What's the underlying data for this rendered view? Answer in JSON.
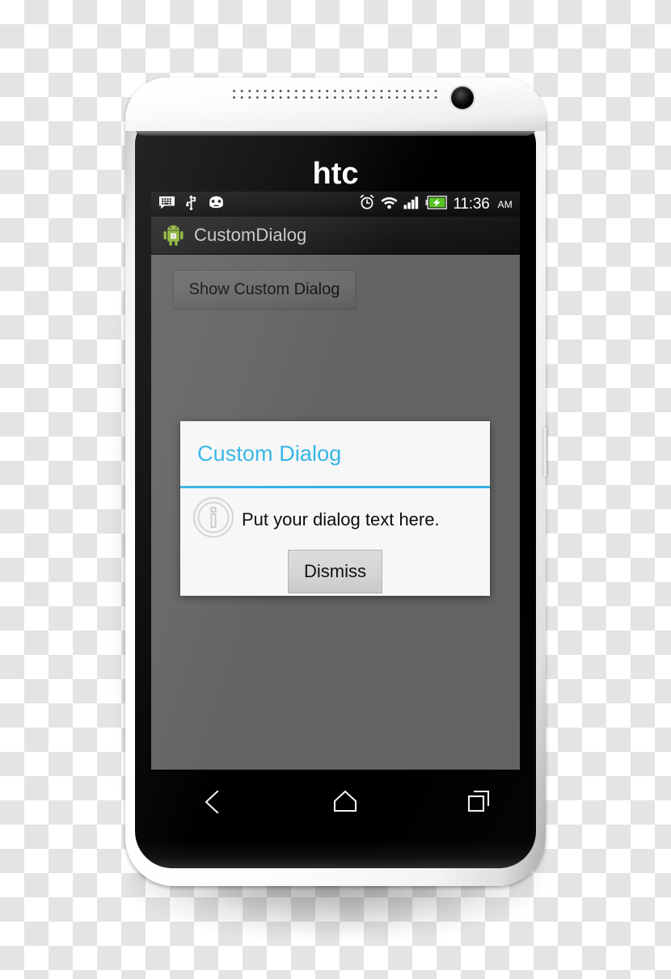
{
  "device": {
    "brand_logo": "htc",
    "hardware": {
      "speaker_grille": "speaker-grille",
      "front_camera": "front-camera-lens",
      "volume_rocker": "volume-button",
      "power_button": "power-button"
    }
  },
  "status_bar": {
    "notification_icons": [
      {
        "name": "sms-message-icon",
        "label": "Messages"
      },
      {
        "name": "usb-icon",
        "label": "USB connected"
      },
      {
        "name": "android-debug-icon",
        "label": "USB debugging connected"
      }
    ],
    "system_icons": [
      {
        "name": "alarm-clock-icon",
        "label": "Alarm set"
      },
      {
        "name": "wifi-icon",
        "label": "Wi-Fi connected"
      },
      {
        "name": "cellular-signal-icon",
        "label": "Signal 4 bars"
      },
      {
        "name": "battery-charging-icon",
        "label": "Battery charging"
      }
    ],
    "clock": {
      "time": "11:36",
      "period": "AM"
    }
  },
  "action_bar": {
    "app_icon": "android-robot-icon",
    "title": "CustomDialog"
  },
  "content": {
    "show_dialog_button": "Show Custom Dialog",
    "background_color": "#636363"
  },
  "dialog": {
    "title": "Custom Dialog",
    "accent_color": "#33b5e5",
    "divider_color": "#34b3e0",
    "background_color": "#f7f7f7",
    "icon": "info-circle-icon",
    "message": "Put your dialog text here.",
    "dismiss_button": "Dismiss"
  },
  "navigation_bar": {
    "buttons": [
      {
        "name": "back-button",
        "label": "Back"
      },
      {
        "name": "home-button",
        "label": "Home"
      },
      {
        "name": "recent-apps-button",
        "label": "Recent apps"
      }
    ]
  }
}
